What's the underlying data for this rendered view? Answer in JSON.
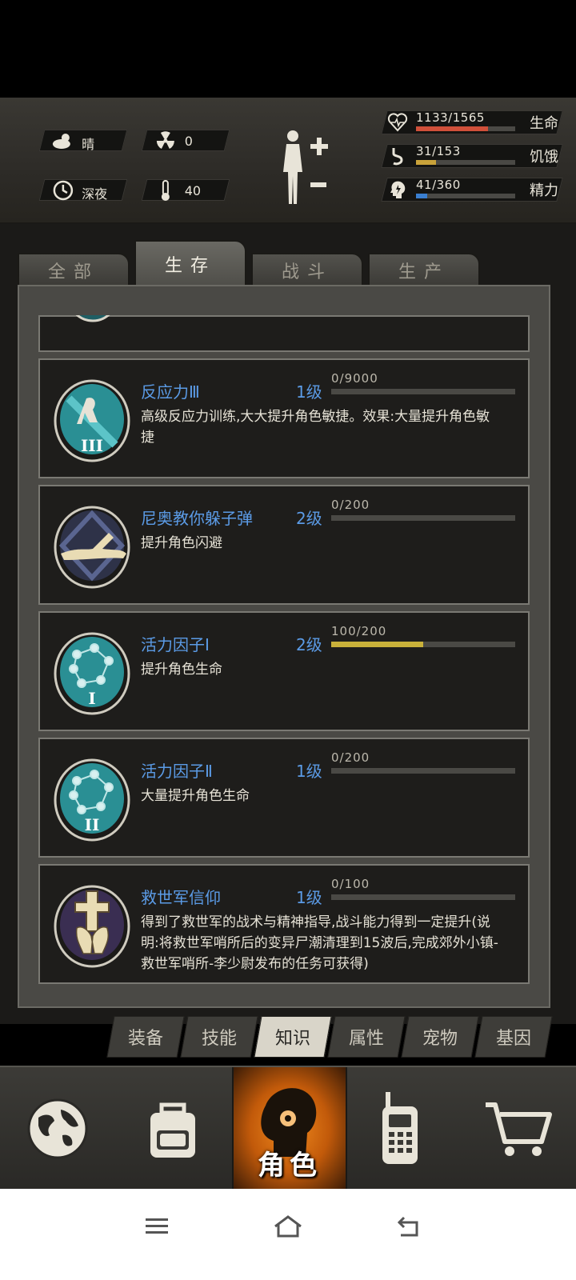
{
  "hud": {
    "weather": {
      "icon": "cloud-sun-icon",
      "text": "晴"
    },
    "radiation": {
      "icon": "radiation-icon",
      "text": "0"
    },
    "time": {
      "icon": "clock-icon",
      "text": "深夜"
    },
    "temperature": {
      "icon": "thermometer-icon",
      "text": "40"
    },
    "stats": [
      {
        "icon": "heart-icon",
        "value": "1133/1565",
        "label": "生命",
        "fill": 0.724,
        "color": "#d0503a"
      },
      {
        "icon": "stomach-icon",
        "value": "31/153",
        "label": "饥饿",
        "fill": 0.203,
        "color": "#c9a23a"
      },
      {
        "icon": "energy-head-icon",
        "value": "41/360",
        "label": "精力",
        "fill": 0.114,
        "color": "#3a7fd0"
      }
    ]
  },
  "tabs": [
    "全部",
    "生存",
    "战斗",
    "生产"
  ],
  "active_tab": 1,
  "skills": [
    {
      "name": "反应力Ⅲ",
      "level": "1级",
      "progress_text": "0/9000",
      "progress": 0.0,
      "desc": "高级反应力训练,大大提升角色敏捷。效果:大量提升角色敏捷",
      "icon": "reflex-icon"
    },
    {
      "name": "尼奥教你躲子弹",
      "level": "2级",
      "progress_text": "0/200",
      "progress": 0.0,
      "desc": "提升角色闪避",
      "icon": "dodge-icon"
    },
    {
      "name": "活力因子Ⅰ",
      "level": "2级",
      "progress_text": "100/200",
      "progress": 0.5,
      "desc": "提升角色生命",
      "icon": "molecule-icon"
    },
    {
      "name": "活力因子Ⅱ",
      "level": "1级",
      "progress_text": "0/200",
      "progress": 0.0,
      "desc": "大量提升角色生命",
      "icon": "molecule-icon"
    },
    {
      "name": "救世军信仰",
      "level": "1级",
      "progress_text": "0/100",
      "progress": 0.0,
      "desc": "得到了救世军的战术与精神指导,战斗能力得到一定提升(说明:将救世军哨所后的变异尸潮清理到15波后,完成郊外小镇-救世军哨所-李少尉发布的任务可获得)",
      "icon": "faith-cross-icon"
    }
  ],
  "subtabs": [
    "装备",
    "技能",
    "知识",
    "属性",
    "宠物",
    "基因"
  ],
  "active_subtab": 2,
  "nav": [
    {
      "icon": "globe-icon",
      "label": ""
    },
    {
      "icon": "backpack-icon",
      "label": ""
    },
    {
      "icon": "character-head-icon",
      "label": "角色"
    },
    {
      "icon": "walkie-talkie-icon",
      "label": ""
    },
    {
      "icon": "cart-icon",
      "label": ""
    }
  ],
  "system": [
    "menu-icon",
    "home-icon",
    "back-icon"
  ]
}
